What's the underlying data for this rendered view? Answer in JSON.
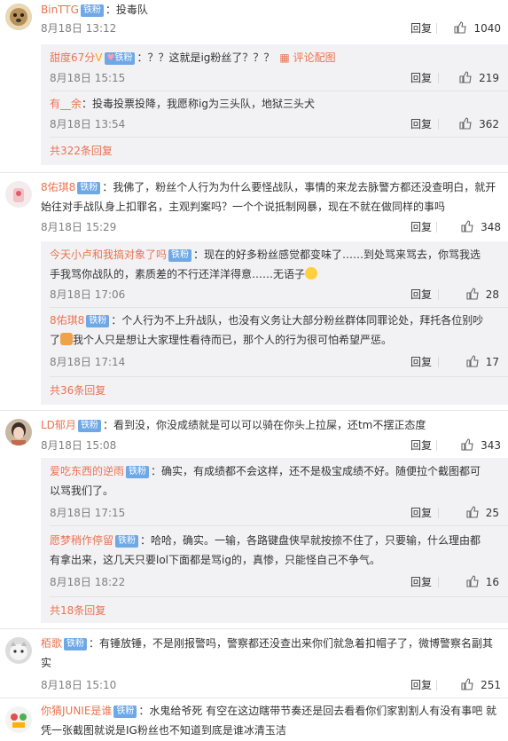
{
  "actions": {
    "reply": "回复"
  },
  "comments": [
    {
      "user": "BinTTG",
      "badge": "铁粉",
      "text": "：投毒队",
      "time": "8月18日 13:12",
      "likes": "1040",
      "replies": [
        {
          "user": "甜度67分",
          "badge": "铁粉",
          "text": "：？？这就是ig粉丝了？？？",
          "review": "评论配图",
          "time": "8月18日 15:15",
          "likes": "219"
        },
        {
          "user": "有__余",
          "text": "：投毒投票投降，我愿称ig为三头队，地狱三头犬",
          "time": "8月18日 13:54",
          "likes": "362"
        }
      ],
      "more": "共322条回复"
    },
    {
      "user": "8佑琪8",
      "badge": "铁粉",
      "text_line1": "：我佛了，粉丝个人行为为什么要怪战队，事情的来龙去脉警方都还没查明白，就开",
      "text_line2": "始往对手战队身上扣罪名，主观判案吗？一个个说抵制网暴，现在不就在做同样的事吗",
      "time": "8月18日 15:29",
      "likes": "348",
      "replies": [
        {
          "user": "今天小卢和我搞对象了吗",
          "badge": "铁粉",
          "text_line1": "：现在的好多粉丝感觉都变味了……到处骂来骂去，你骂我选",
          "text_line2": "手我骂你战队的，素质差的不行还洋洋得意……无语子",
          "time": "8月18日 17:06",
          "likes": "28"
        },
        {
          "user": "8佑琪8",
          "badge": "铁粉",
          "text_line1": "：个人行为不上升战队，也没有义务让大部分粉丝群体同罪论处，拜托各位别吵",
          "text_line2": "了",
          "text_line2b": "我个人只是想让大家理性看待而已，那个人的行为很可怕希望严惩。",
          "time": "8月18日 17:14",
          "likes": "17"
        }
      ],
      "more": "共36条回复"
    },
    {
      "user": "LD郁月",
      "badge": "铁粉",
      "text": "：看到没，你没成绩就是可以可以骑在你头上拉屎，还tm不摆正态度",
      "time": "8月18日 15:08",
      "likes": "343",
      "replies": [
        {
          "user": "爱吃东西的逆雨",
          "badge": "铁粉",
          "text_line1": "：确实，有成绩都不会这样，还不是极宝成绩不好。随便拉个截图都可",
          "text_line2": "以骂我们了。",
          "time": "8月18日 17:15",
          "likes": "25"
        },
        {
          "user": "愿梦稍作停留",
          "badge": "铁粉",
          "text_line1": "：哈哈，确实。一输，各路键盘侠早就按捺不住了，只要输，什么理由都",
          "text_line2": "有拿出来，这几天只要lol下面都是骂ig的，真惨，只能怪自己不争气。",
          "time": "8月18日 18:22",
          "likes": "16"
        }
      ],
      "more": "共18条回复"
    },
    {
      "user": "栢歌",
      "badge": "铁粉",
      "text_line1": "：有锤放锤，不是刚报警吗，警察都还没查出来你们就急着扣帽子了，微博警察名副其",
      "text_line2": "实",
      "time": "8月18日 15:10",
      "likes": "251"
    },
    {
      "user": "你猜JUNIE是谁",
      "badge": "铁粉",
      "text_line1": "：水鬼给爷死 有空在这边瞎带节奏还是回去看看你们家割割人有没有事吧 就",
      "text_line2": "凭一张截图就说是IG粉丝也不知道到底是谁冰清玉洁"
    }
  ]
}
